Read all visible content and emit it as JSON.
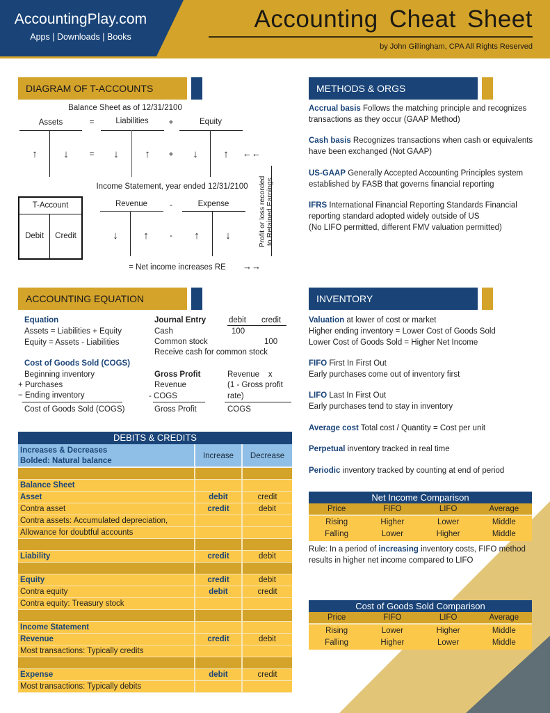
{
  "header": {
    "site_name": "AccountingPlay.com",
    "site_links": "Apps | Downloads | Books",
    "title": "Accounting Cheat Sheet",
    "byline": "by John Gillingham, CPA All Rights Reserved"
  },
  "colors": {
    "navy": "#1a4478",
    "gold": "#d4a32a",
    "light_gold": "#fcc84a",
    "light_blue": "#8fbfe6",
    "slate": "#5f6f75"
  },
  "t_accounts": {
    "heading": "DIAGRAM OF T-ACCOUNTS",
    "balance_sheet_caption": "Balance Sheet as of 12/31/2100",
    "assets_label": "Assets",
    "liabilities_label": "Liabilities",
    "equity_label": "Equity",
    "op_equals": "=",
    "op_plus": "+",
    "op_minus": "-",
    "arrow_up": "↑",
    "arrow_down": "↓",
    "arrow_left_pair": "←←",
    "arrow_right_pair": "→→",
    "income_caption": "Income Statement, year ended 12/31/2100",
    "t_account_title": "T-Account",
    "debit_label": "Debit",
    "credit_label": "Credit",
    "revenue_label": "Revenue",
    "expense_label": "Expense",
    "net_income_note": "= Net income increases RE",
    "vertical_note_line1": "Profit or loss recorded",
    "vertical_note_line2": "to Retained Earnings"
  },
  "methods": {
    "heading": "METHODS & ORGS",
    "items": [
      {
        "term": "Accrual basis",
        "text": " Follows the matching principle and recognizes transactions as they occur (GAAP Method)"
      },
      {
        "term": "Cash basis",
        "text": " Recognizes transactions when cash or equivalents have been exchanged (Not GAAP)"
      },
      {
        "term": "US-GAAP",
        "text": " Generally Accepted Accounting Principles system established by FASB that governs financial reporting"
      },
      {
        "term": "IFRS",
        "text": " International Financial Reporting Standards Financial reporting standard adopted widely outside of US",
        "text2": "(No LIFO permitted, different FMV valuation permitted)"
      }
    ]
  },
  "equation": {
    "heading": "ACCOUNTING EQUATION",
    "equation_title": "Equation",
    "equation_lines": [
      "Assets = Liabilities + Equity",
      "Equity = Assets - Liabilities"
    ],
    "cogs_title": "Cost of Goods Sold (COGS)",
    "cogs_lines": [
      "Beginning inventory",
      "+ Purchases",
      "− Ending inventory"
    ],
    "cogs_result": "Cost of Goods Sold (COGS)",
    "journal_title": "Journal Entry",
    "journal_debit_head": "debit",
    "journal_credit_head": "credit",
    "journal_rows": [
      {
        "account": "Cash",
        "debit": "100",
        "credit": ""
      },
      {
        "account": "Common stock",
        "debit": "",
        "credit": "100"
      }
    ],
    "journal_memo": "Receive cash for common stock",
    "gp_title": "Gross Profit",
    "gp_lines": [
      "Revenue",
      "- COGS"
    ],
    "gp_result": "Gross Profit",
    "gp_alt_lines": [
      "Revenue    x",
      "(1 - Gross profit",
      "rate)"
    ],
    "gp_alt_result": "COGS"
  },
  "debits_credits": {
    "title": "DEBITS & CREDITS",
    "head_line1": "Increases & Decreases",
    "head_line2_bold": "Bolded:",
    "head_line2_rest": " Natural balance",
    "col_increase": "Increase",
    "col_decrease": "Decrease",
    "rows": [
      {
        "type": "spacer"
      },
      {
        "label": "Balance Sheet",
        "style": "section",
        "inc": "",
        "dec": ""
      },
      {
        "label": "Asset",
        "style": "section",
        "inc": "debit",
        "dec": "credit"
      },
      {
        "label": "Contra asset",
        "style": "normal",
        "inc": "credit",
        "dec": "debit"
      },
      {
        "label": "Contra assets: Accumulated depreciation,",
        "style": "normal",
        "inc": "",
        "dec": ""
      },
      {
        "label": "Allowance for doubtful accounts",
        "style": "normal",
        "inc": "",
        "dec": ""
      },
      {
        "type": "spacer"
      },
      {
        "label": "Liability",
        "style": "section",
        "inc": "credit",
        "dec": "debit"
      },
      {
        "type": "spacer"
      },
      {
        "label": "Equity",
        "style": "section",
        "inc": "credit",
        "dec": "debit"
      },
      {
        "label": "Contra equity",
        "style": "normal",
        "inc": "debit",
        "dec": "credit"
      },
      {
        "label": "Contra equity: Treasury stock",
        "style": "normal",
        "inc": "",
        "dec": ""
      },
      {
        "type": "spacer"
      },
      {
        "label": "Income Statement",
        "style": "section",
        "inc": "",
        "dec": ""
      },
      {
        "label": "Revenue",
        "style": "section",
        "inc": "credit",
        "dec": "debit"
      },
      {
        "label": "Most transactions: Typically credits",
        "style": "normal",
        "inc": "",
        "dec": ""
      },
      {
        "type": "spacer"
      },
      {
        "label": "Expense",
        "style": "section",
        "inc": "debit",
        "dec": "credit"
      },
      {
        "label": "Most transactions: Typically debits",
        "style": "normal",
        "inc": "",
        "dec": ""
      }
    ]
  },
  "inventory": {
    "heading": "INVENTORY",
    "items": [
      {
        "term": "Valuation",
        "text": " at lower of cost or market",
        "extra": [
          "Higher ending inventory = Lower Cost of Goods Sold",
          "Lower Cost of Goods Sold = Higher Net Income"
        ]
      },
      {
        "term": "FIFO",
        "text": " First In First Out",
        "extra": [
          "Early purchases come out of inventory first"
        ]
      },
      {
        "term": "LIFO",
        "text": " Last In First Out",
        "extra": [
          "Early purchases tend to stay in inventory"
        ]
      },
      {
        "term": "Average cost",
        "text": " Total cost / Quantity = Cost per unit",
        "extra": []
      },
      {
        "term": "Perpetual",
        "text": " inventory tracked in real time",
        "extra": []
      },
      {
        "term": "Periodic",
        "text": " inventory tracked by counting at end of period",
        "extra": []
      }
    ]
  },
  "net_income_comparison": {
    "title": "Net Income Comparison",
    "columns": [
      "Price",
      "FIFO",
      "LIFO",
      "Average"
    ],
    "rows": [
      [
        "Rising",
        "Higher",
        "Lower",
        "Middle"
      ],
      [
        "Falling",
        "Lower",
        "Higher",
        "Middle"
      ]
    ],
    "rule_prefix": "Rule: In a period of ",
    "rule_keyword": "increasing",
    "rule_suffix": " inventory costs, FIFO method results in higher net income compared to LIFO"
  },
  "cogs_comparison": {
    "title": "Cost of Goods Sold Comparison",
    "columns": [
      "Price",
      "FIFO",
      "LIFO",
      "Average"
    ],
    "rows": [
      [
        "Rising",
        "Lower",
        "Higher",
        "Middle"
      ],
      [
        "Falling",
        "Higher",
        "Lower",
        "Middle"
      ]
    ]
  }
}
